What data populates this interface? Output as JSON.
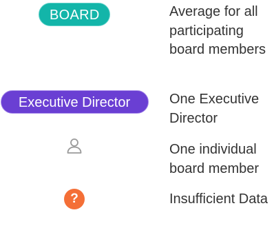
{
  "legend": {
    "rows": [
      {
        "symbol_label": "BOARD",
        "description": "Average for all participating board members",
        "color": "#13b5a9"
      },
      {
        "symbol_label": "Executive Director",
        "description": "One Executive Director",
        "color": "#6a3fd3"
      },
      {
        "icon": "person-outline-icon",
        "description": "One individual board member",
        "color": "#9a9a9a"
      },
      {
        "symbol_label": "?",
        "icon": "question-mark-icon",
        "description": "Insufficient Data",
        "color": "#f46f37"
      }
    ]
  }
}
